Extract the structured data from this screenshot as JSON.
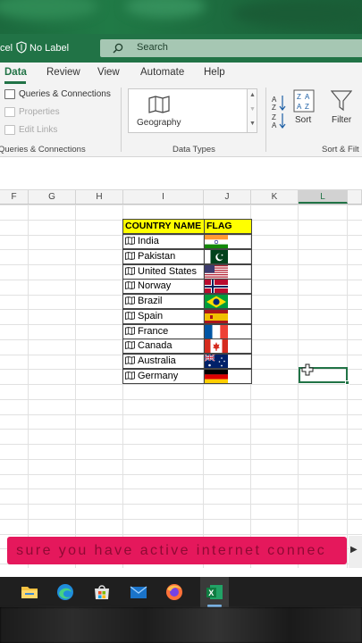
{
  "titlebar": {
    "app_fragment": "cel",
    "sensitivity_label": "No Label",
    "search_placeholder": "Search"
  },
  "tabs": [
    "Data",
    "Review",
    "View",
    "Automate",
    "Help"
  ],
  "active_tab": "Data",
  "ribbon": {
    "queries_connections": "Queries & Connections",
    "properties": "Properties",
    "edit_links": "Edit Links",
    "group_queries": "Queries & Connections",
    "geography": "Geography",
    "group_data_types": "Data Types",
    "sort": "Sort",
    "filter": "Filter",
    "group_sort_filter": "Sort & Filt"
  },
  "columns": [
    "F",
    "G",
    "H",
    "I",
    "J",
    "K",
    "L"
  ],
  "selected_column": "L",
  "table": {
    "header_country": "COUNTRY NAME",
    "header_flag": "FLAG",
    "rows": [
      {
        "country": "India",
        "flag": "india"
      },
      {
        "country": "Pakistan",
        "flag": "pakistan"
      },
      {
        "country": "United States",
        "flag": "usa"
      },
      {
        "country": "Norway",
        "flag": "norway"
      },
      {
        "country": "Brazil",
        "flag": "brazil"
      },
      {
        "country": "Spain",
        "flag": "spain"
      },
      {
        "country": "France",
        "flag": "france"
      },
      {
        "country": "Canada",
        "flag": "canada"
      },
      {
        "country": "Australia",
        "flag": "australia"
      },
      {
        "country": "Germany",
        "flag": "germany"
      }
    ]
  },
  "banner_text": "e sure you have active internet connec",
  "taskbar_icons": [
    "file-explorer-icon",
    "edge-icon",
    "store-icon",
    "mail-icon",
    "firefox-icon",
    "excel-icon"
  ],
  "colors": {
    "excel_green": "#217346",
    "header_yellow": "#ffff00",
    "banner_pink": "#e5185c"
  }
}
